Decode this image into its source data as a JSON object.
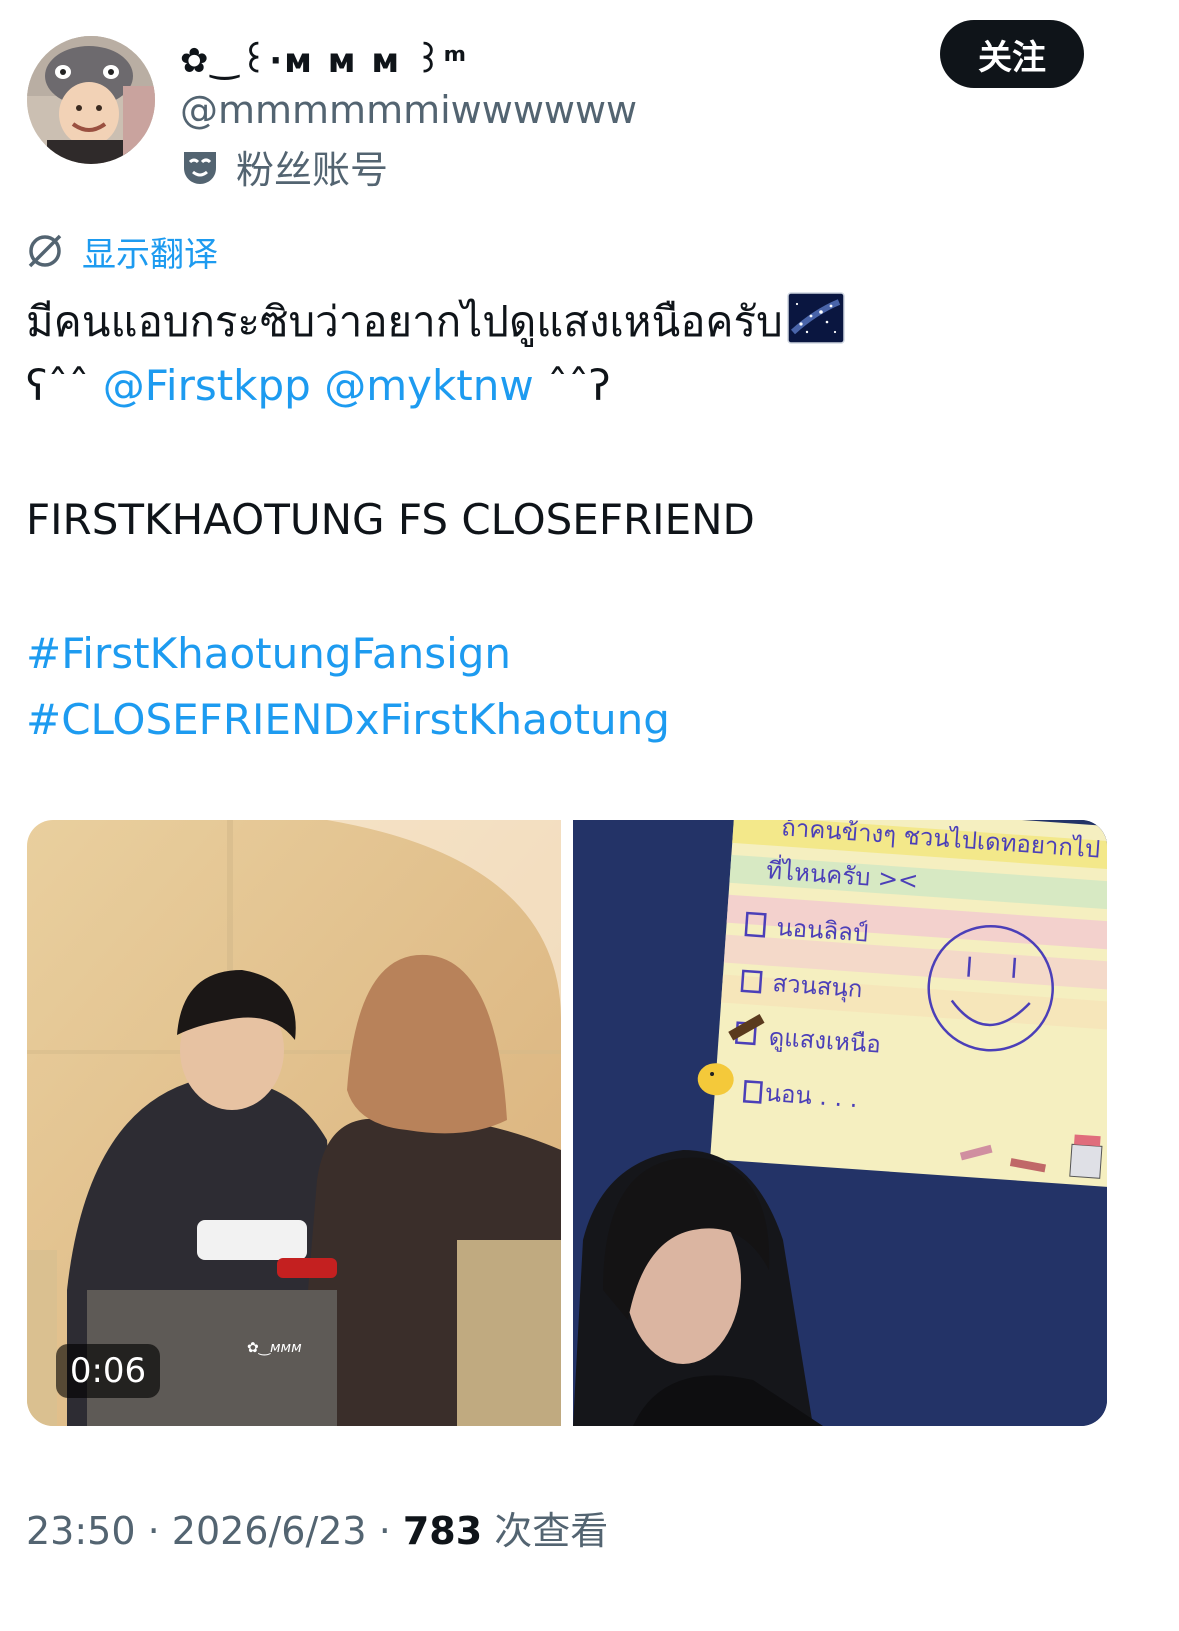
{
  "author": {
    "display_name": "✿‿꒰·ᴍ ᴍ ᴍ ꒱ᵐ",
    "handle": "@mmmmmmiwwwwww",
    "account_type_label": "粉丝账号",
    "follow_label": "关注"
  },
  "translate_label": "显示翻译",
  "tweet": {
    "line1": "มีคนแอบกระซิบว่าอยากไปดูแสงเหนือครับ",
    "line2_open": "ʕˆˆ",
    "mention1": "@Firstkpp",
    "mention2": "@myktnw",
    "line2_close": "ˆˆʔ",
    "line3": "FIRSTKHAOTUNG FS CLOSEFRIEND",
    "hashtag1": "#FirstKhaotungFansign",
    "hashtag2": "#CLOSEFRIENDxFirstKhaotung"
  },
  "media": {
    "video_duration": "0:06",
    "video_watermark": "✿‿ᴍᴍᴍ",
    "note_lines": [
      "ถ้าคนข้างๆ ชวนไปเดทอยากไป",
      "ที่ไหนครับ ><",
      "นอนลิลป์",
      "สวนสนุก",
      "ดูแสงเหนือ",
      "นอน . . ."
    ]
  },
  "footer": {
    "time": "23:50",
    "sep": " · ",
    "date": "2026/6/23",
    "views_count": "783",
    "views_label": "次查看"
  },
  "colors": {
    "link": "#1d9bf0",
    "muted": "#536471",
    "text": "#0f1419"
  }
}
